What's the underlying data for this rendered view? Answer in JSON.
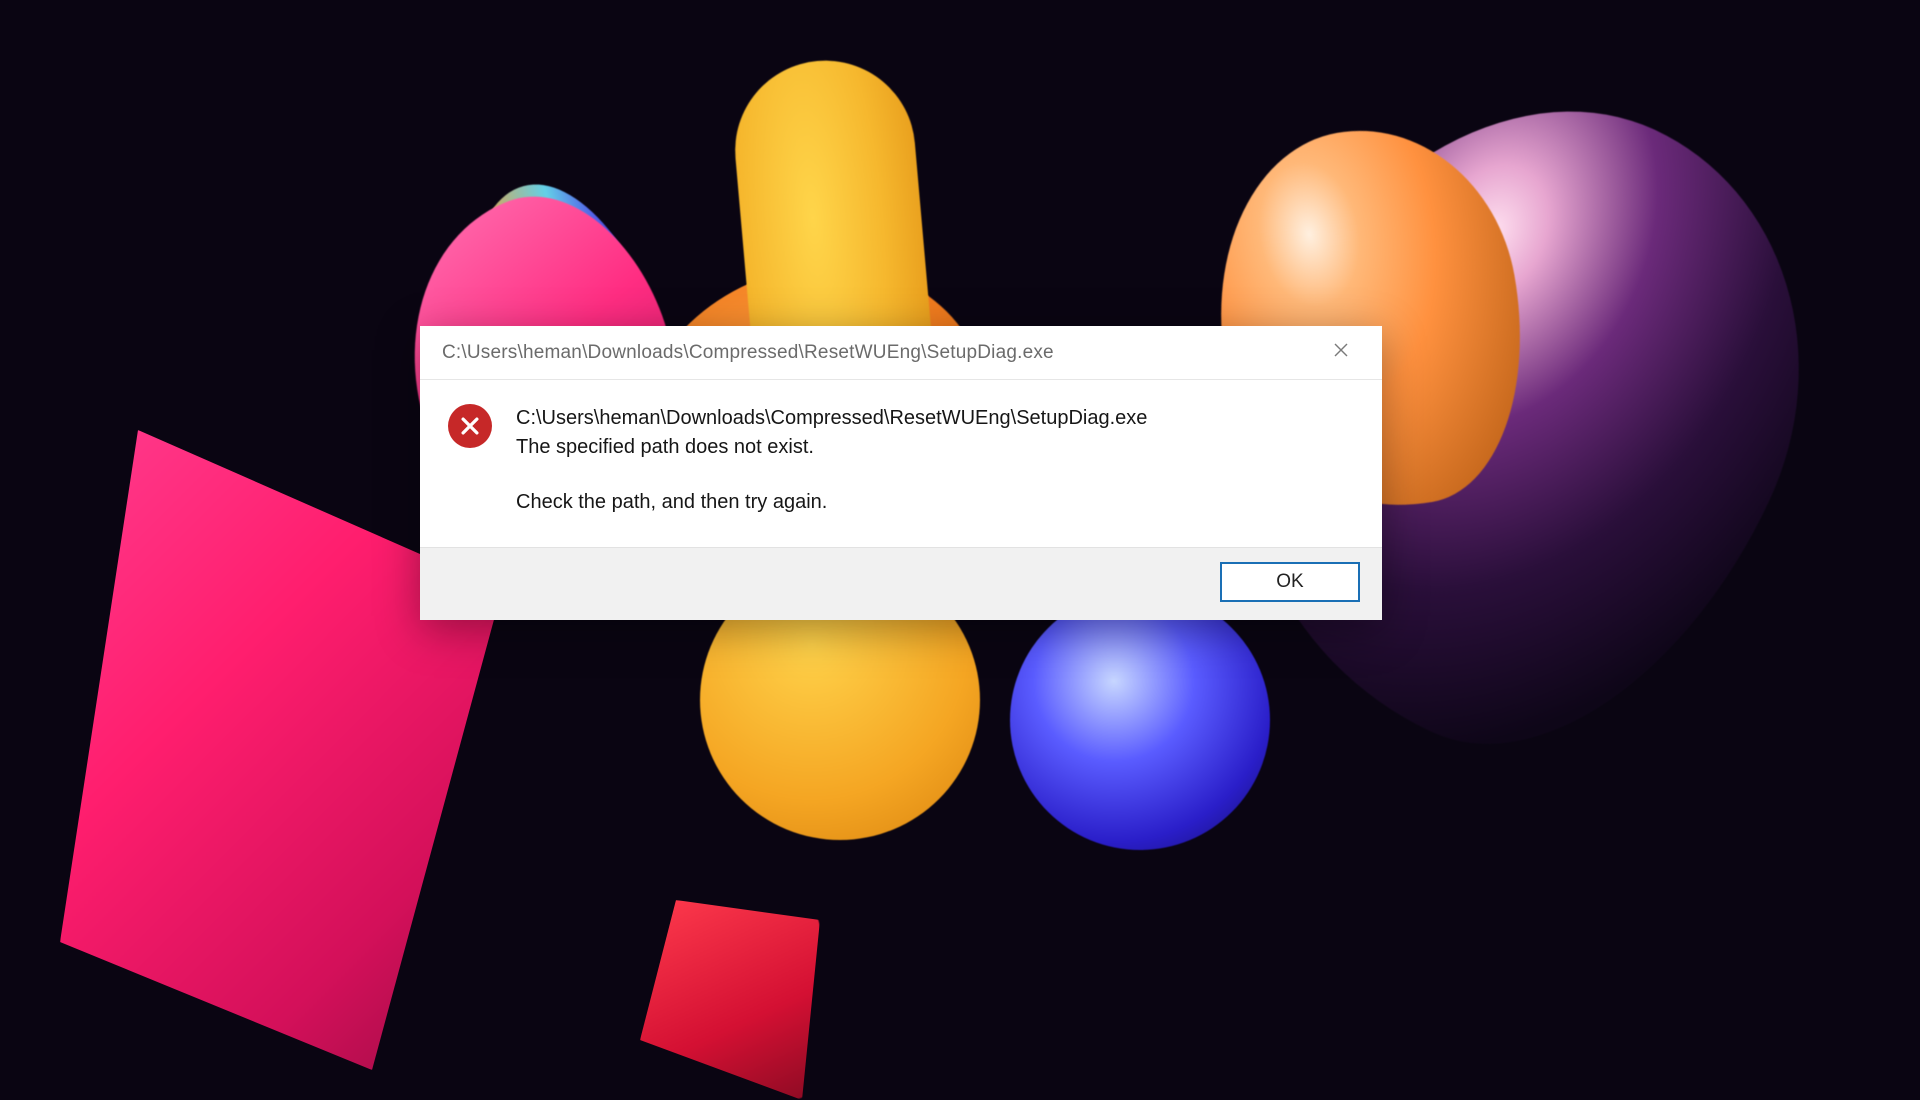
{
  "dialog": {
    "title": "C:\\Users\\heman\\Downloads\\Compressed\\ResetWUEng\\SetupDiag.exe",
    "message_path": "C:\\Users\\heman\\Downloads\\Compressed\\ResetWUEng\\SetupDiag.exe",
    "message_error": "The specified path does not exist.",
    "message_hint": "Check the path, and then try again.",
    "ok_label": "OK"
  }
}
